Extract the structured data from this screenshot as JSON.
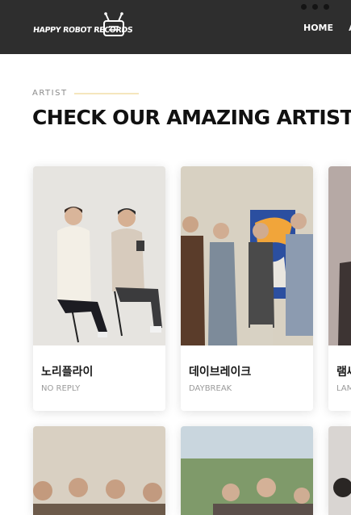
{
  "header": {
    "logo_text": "HAPPY ROBOT RECORDS",
    "nav": [
      {
        "label": "HOME"
      },
      {
        "label": "AB"
      }
    ]
  },
  "section": {
    "eyebrow": "ARTIST",
    "title": "CHECK OUR AMAZING ARTIST"
  },
  "artists": [
    {
      "name": "노리플라이",
      "subtitle": "NO REPLY"
    },
    {
      "name": "데이브레이크",
      "subtitle": "DAYBREAK"
    },
    {
      "name": "램씨",
      "subtitle": "LAMI"
    }
  ],
  "colors": {
    "header_bg": "#2e2e2e",
    "accent_line": "#f5e6bd",
    "title_text": "#111111"
  }
}
